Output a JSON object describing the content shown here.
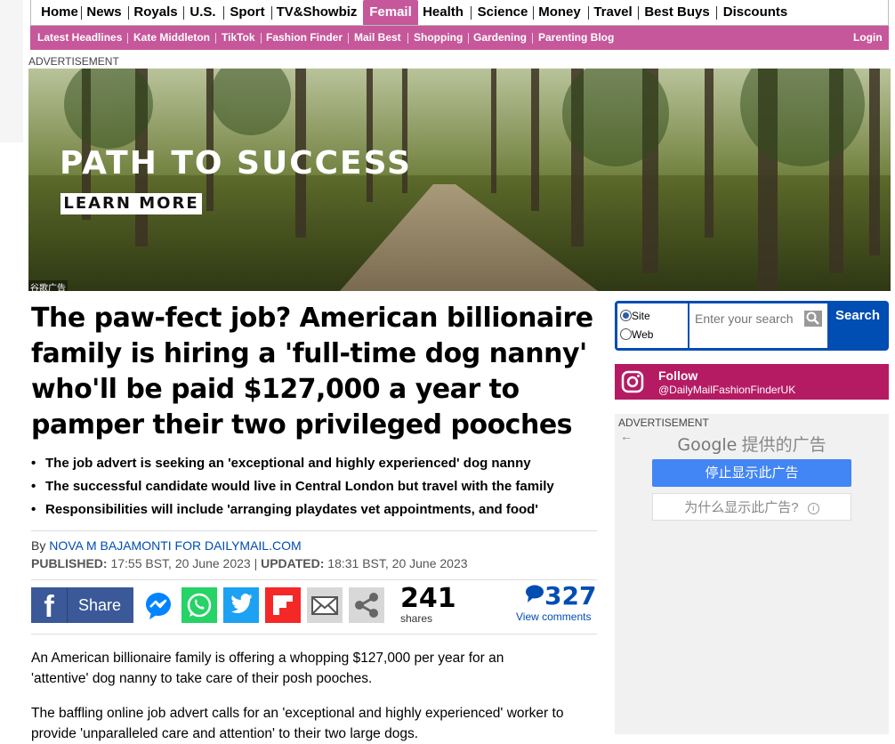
{
  "nav": {
    "primary": [
      "Home",
      "News",
      "Royals",
      "U.S.",
      "Sport",
      "TV&Showbiz",
      "Femail",
      "Health",
      "Science",
      "Money",
      "Travel",
      "Best Buys",
      "Discounts"
    ],
    "secondary": [
      "Latest Headlines",
      "Kate Middleton",
      "TikTok",
      "Fashion Finder",
      "Mail Best",
      "Shopping",
      "Gardening",
      "Parenting Blog"
    ],
    "login": "Login"
  },
  "ad_label": "ADVERTISEMENT",
  "banner": {
    "title": "PATH TO SUCCESS",
    "button": "LEARN MORE",
    "ad_tag": "谷歌广告"
  },
  "article": {
    "headline": "The paw-fect job? American billionaire family is hiring a 'full-time dog nanny' who'll be paid $127,000 a year to pamper their two privileged pooches",
    "bullets": [
      "The job advert is seeking an 'exceptional and highly experienced' dog nanny",
      "The successful candidate would live in Central London but travel with the family",
      "Responsibilities will include 'arranging playdates vet appointments, and food'"
    ],
    "by_prefix": "By",
    "author": "NOVA M BAJAMONTI FOR DAILYMAIL.COM",
    "published_label": "PUBLISHED:",
    "published": "17:55 BST, 20 June 2023",
    "updated_label": "UPDATED:",
    "updated": "18:31 BST, 20 June 2023",
    "share_label": "Share",
    "share_count": "241",
    "shares_label": "shares",
    "comment_count": "327",
    "view_comments": "View comments",
    "paragraphs": [
      "An American billionaire family is offering a whopping $127,000 per year for an 'attentive' dog nanny to take care of their posh pooches.",
      "The baffling online job advert calls for an 'exceptional and highly experienced' worker to provide 'unparalleled care and attention' to their two large dogs."
    ]
  },
  "search": {
    "option_site": "Site",
    "option_web": "Web",
    "placeholder": "Enter your search",
    "button": "Search"
  },
  "instagram": {
    "follow": "Follow",
    "handle": "@DailyMailFashionFinderUK"
  },
  "google_ad": {
    "brand": "Google",
    "provided": "提供的广告",
    "stop": "停止显示此广告",
    "why": "为什么显示此广告?"
  },
  "colors": {
    "femail_pink": "#c6579a",
    "link_blue": "#004db3",
    "instagram": "#b51b63",
    "facebook": "#3b5998"
  }
}
